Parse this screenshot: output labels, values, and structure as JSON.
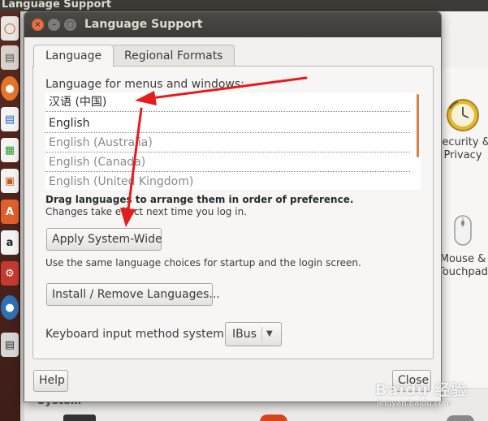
{
  "desktop": {
    "top_bar_title": "Language Support",
    "settings_items": [
      {
        "label": "Security &\nPrivacy",
        "icon": "clock-icon"
      },
      {
        "label": "Mouse &\nTouchpad",
        "icon": "mouse-icon"
      }
    ],
    "bottom_section_label": "System"
  },
  "dialog": {
    "title": "Language Support",
    "tabs": [
      {
        "label": "Language",
        "selected": true
      },
      {
        "label": "Regional Formats",
        "selected": false
      }
    ],
    "language_tab": {
      "list_label": "Language for menus and windows:",
      "languages": [
        {
          "label": "汉语 (中国)",
          "active": true
        },
        {
          "label": "English",
          "active": true
        },
        {
          "label": "English (Australia)",
          "active": false
        },
        {
          "label": "English (Canada)",
          "active": false
        },
        {
          "label": "English (United Kingdom)",
          "active": false
        }
      ],
      "hint_bold": "Drag languages to arrange them in order of preference.",
      "hint_normal": "Changes take effect next time you log in.",
      "apply_button": "Apply System-Wide",
      "apply_description": "Use the same language choices for startup and the login screen.",
      "install_button": "Install / Remove Languages...",
      "keyboard_label": "Keyboard input method system:",
      "keyboard_value": "IBus"
    },
    "help_button": "Help",
    "close_button": "Close"
  },
  "watermark": {
    "brand": "Baidu 经验",
    "url": "jingyan.baidu.com"
  },
  "colors": {
    "titlebar": "#3c3b37",
    "accent_orange": "#df7f43",
    "close_button": "#e05424",
    "annotation_arrow": "#e31d1d",
    "launcher": "#4a221c"
  }
}
